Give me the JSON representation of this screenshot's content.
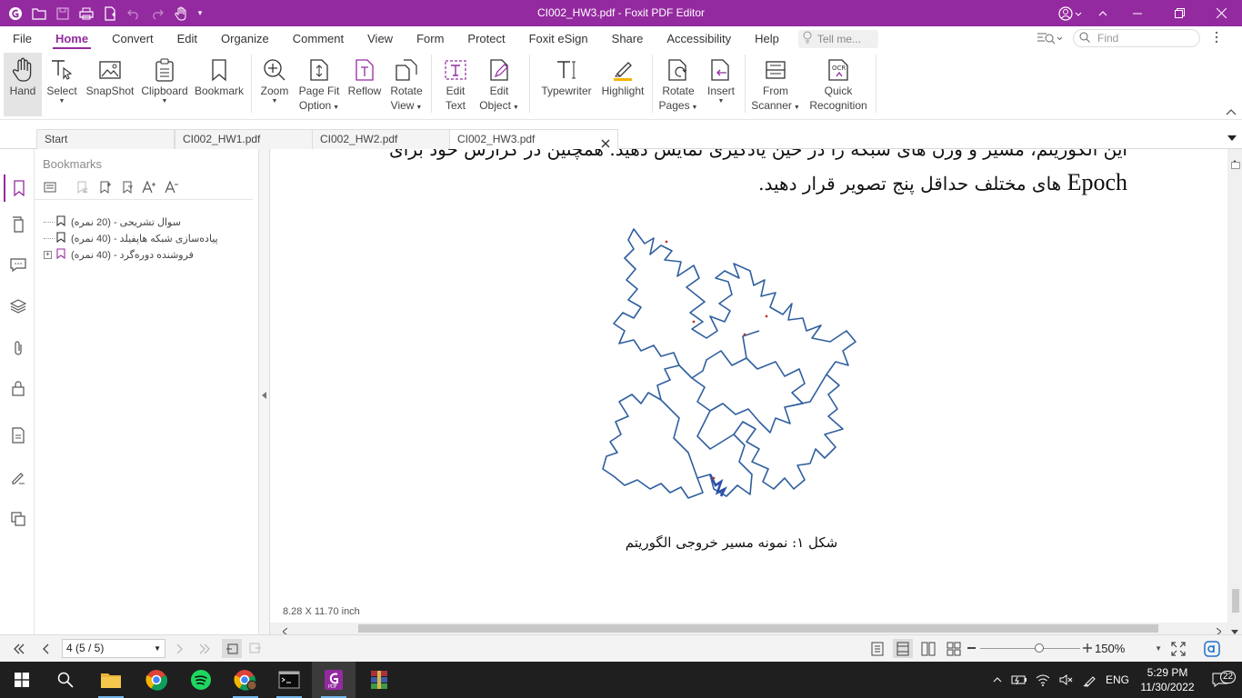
{
  "window": {
    "title": "CI002_HW3.pdf - Foxit PDF Editor",
    "accent": "#942aa0",
    "quick_access": [
      "open-icon",
      "save-icon",
      "print-icon",
      "new-icon",
      "undo-icon",
      "redo-icon",
      "hand-tool-icon",
      "customize-icon"
    ],
    "controls": [
      "account-icon",
      "ribbon-options-icon",
      "minimize-icon",
      "restore-icon",
      "close-icon"
    ]
  },
  "menu": {
    "items": [
      "File",
      "Home",
      "Convert",
      "Edit",
      "Organize",
      "Comment",
      "View",
      "Form",
      "Protect",
      "Foxit eSign",
      "Share",
      "Accessibility",
      "Help"
    ],
    "active": "Home",
    "tell_me": "Tell me...",
    "find_placeholder": "Find"
  },
  "ribbon": {
    "hand": "Hand",
    "select": "Select",
    "snapshot": "SnapShot",
    "clipboard": "Clipboard",
    "bookmark": "Bookmark",
    "zoom": "Zoom",
    "page_fit_1": "Page Fit",
    "page_fit_2": "Option",
    "reflow": "Reflow",
    "rotate_view_1": "Rotate",
    "rotate_view_2": "View",
    "edit_text_1": "Edit",
    "edit_text_2": "Text",
    "edit_object_1": "Edit",
    "edit_object_2": "Object",
    "typewriter": "Typewriter",
    "highlight": "Highlight",
    "rotate_pages_1": "Rotate",
    "rotate_pages_2": "Pages",
    "insert": "Insert",
    "from_scanner_1": "From",
    "from_scanner_2": "Scanner",
    "quick_recog_1": "Quick",
    "quick_recog_2": "Recognition"
  },
  "tabs": {
    "start": "Start",
    "hw1": "CI002_HW1.pdf",
    "hw2": "CI002_HW2.pdf",
    "hw3": "CI002_HW3.pdf"
  },
  "bookmarks": {
    "title": "Bookmarks",
    "items": [
      {
        "label": "سوال تشریحی - (20 نمره)"
      },
      {
        "label": "پیاده‌سازی شبکه هاپفیلد - (40 نمره)"
      },
      {
        "label": "فروشنده دوره‌گرد - (40 نمره)"
      }
    ]
  },
  "document": {
    "line_top": "این الگوریتم، مسیر و وزن های شبکه را در حین یادگیری نمایش دهید. همچنین در گزارش خود برای",
    "line_epoch_word": "Epoch",
    "line_epoch_rest": "های مختلف حداقل پنج تصویر قرار دهید.",
    "caption": "شکل ۱: نمونه مسیر خروجی الگوریتم",
    "page_size": "8.28 X 11.70 inch"
  },
  "status": {
    "page_value": "4 (5 / 5)",
    "zoom_value": "150%",
    "zoom_fraction": 0.59
  },
  "taskbar": {
    "apps": [
      "file-explorer-icon",
      "chrome-icon",
      "spotify-icon",
      "chrome-profile-icon",
      "terminal-icon",
      "foxit-icon",
      "winrar-icon"
    ],
    "language": "ENG",
    "time": "5:29 PM",
    "date": "11/30/2022",
    "notifications": "22"
  }
}
